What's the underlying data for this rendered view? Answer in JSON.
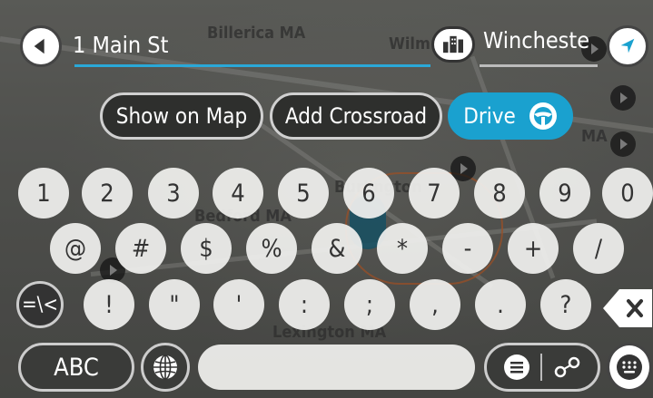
{
  "map": {
    "labels": [
      "Billerica MA",
      "Wilm",
      "Bedford MA",
      "Burlington",
      "Lexington MA",
      "MA"
    ]
  },
  "search": {
    "value": "1 Main St",
    "city": "Winchester,"
  },
  "actions": {
    "show_on_map": "Show on Map",
    "add_crossroad": "Add Crossroad",
    "drive": "Drive"
  },
  "keyboard": {
    "row1": [
      "1",
      "2",
      "3",
      "4",
      "5",
      "6",
      "7",
      "8",
      "9",
      "0"
    ],
    "row2": [
      "@",
      "#",
      "$",
      "%",
      "&",
      "*",
      "-",
      "+",
      "/"
    ],
    "row3": [
      "=\\<",
      "!",
      "\"",
      "'",
      ":",
      ";",
      ",",
      ".",
      "?"
    ],
    "abc": "ABC"
  },
  "colors": {
    "accent": "#1aa1cf",
    "underline": "#2aa8d8"
  },
  "icons": {
    "back": "back-arrow-icon",
    "city": "city-buildings-icon",
    "nav": "navigation-arrow-icon",
    "wheel": "steering-wheel-icon",
    "globe": "globe-icon",
    "list": "list-icon",
    "pin": "map-pin-icon",
    "backspace": "backspace-icon",
    "keyboard": "keyboard-icon"
  }
}
